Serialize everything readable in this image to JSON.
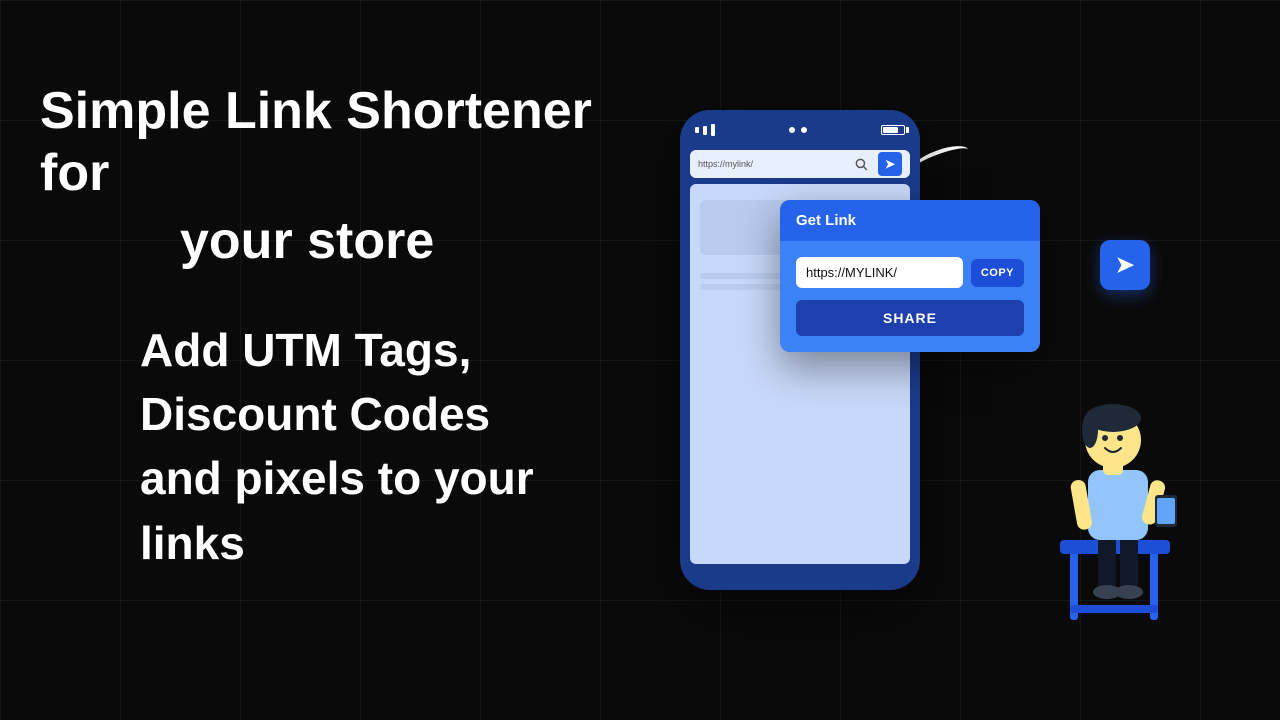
{
  "background": "#0a0a0a",
  "left": {
    "headline1": "Simple Link Shortener for",
    "headline2": "your store",
    "feature1": "Add UTM Tags,",
    "feature2": "Discount Codes",
    "feature3": "and pixels to your links"
  },
  "right": {
    "phone": {
      "address_bar_text": "https://mylink/",
      "search_placeholder": "https://mylink/"
    },
    "popup": {
      "header": "Get Link",
      "link_url": "https://MYLINK/",
      "copy_label": "COPY",
      "share_label": "SHARE"
    },
    "floating_icon": "➤"
  }
}
